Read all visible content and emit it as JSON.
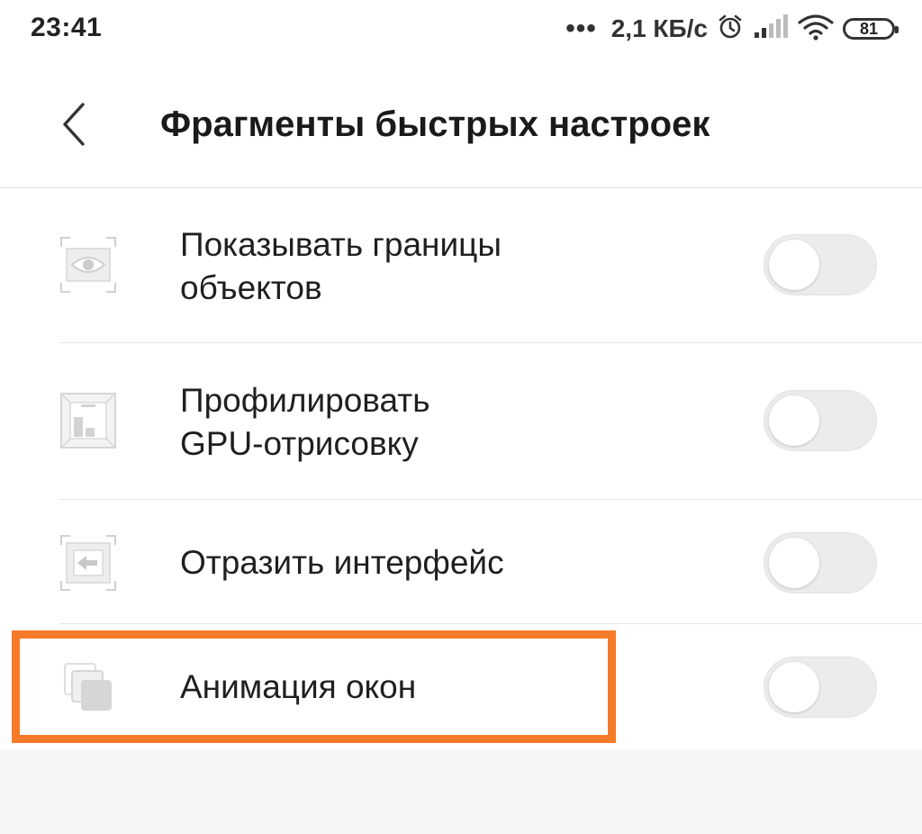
{
  "status_bar": {
    "time": "23:41",
    "dots": "•••",
    "net_speed": "2,1 КБ/с",
    "battery_level": "81",
    "icons": [
      "alarm-icon",
      "signal-icon",
      "wifi-icon",
      "battery-icon"
    ]
  },
  "header": {
    "back_icon": "chevron-left-icon",
    "title": "Фрагменты быстрых настроек"
  },
  "items": [
    {
      "label_line1": "Показывать границы",
      "label_line2": "объектов",
      "icon": "eye-frame-icon",
      "enabled": false
    },
    {
      "label_line1": "Профилировать",
      "label_line2": "GPU-отрисовку",
      "icon": "gpu-profile-icon",
      "enabled": false
    },
    {
      "label": "Отразить интерфейс",
      "icon": "mirror-arrow-icon",
      "enabled": false
    },
    {
      "label": "Анимация окон",
      "icon": "window-stack-icon",
      "enabled": false
    }
  ],
  "colors": {
    "highlight": "#f57a2a",
    "toggle_off": "#ececec",
    "page_bg": "#ffffff",
    "footer_bg": "#f5f5f5"
  }
}
